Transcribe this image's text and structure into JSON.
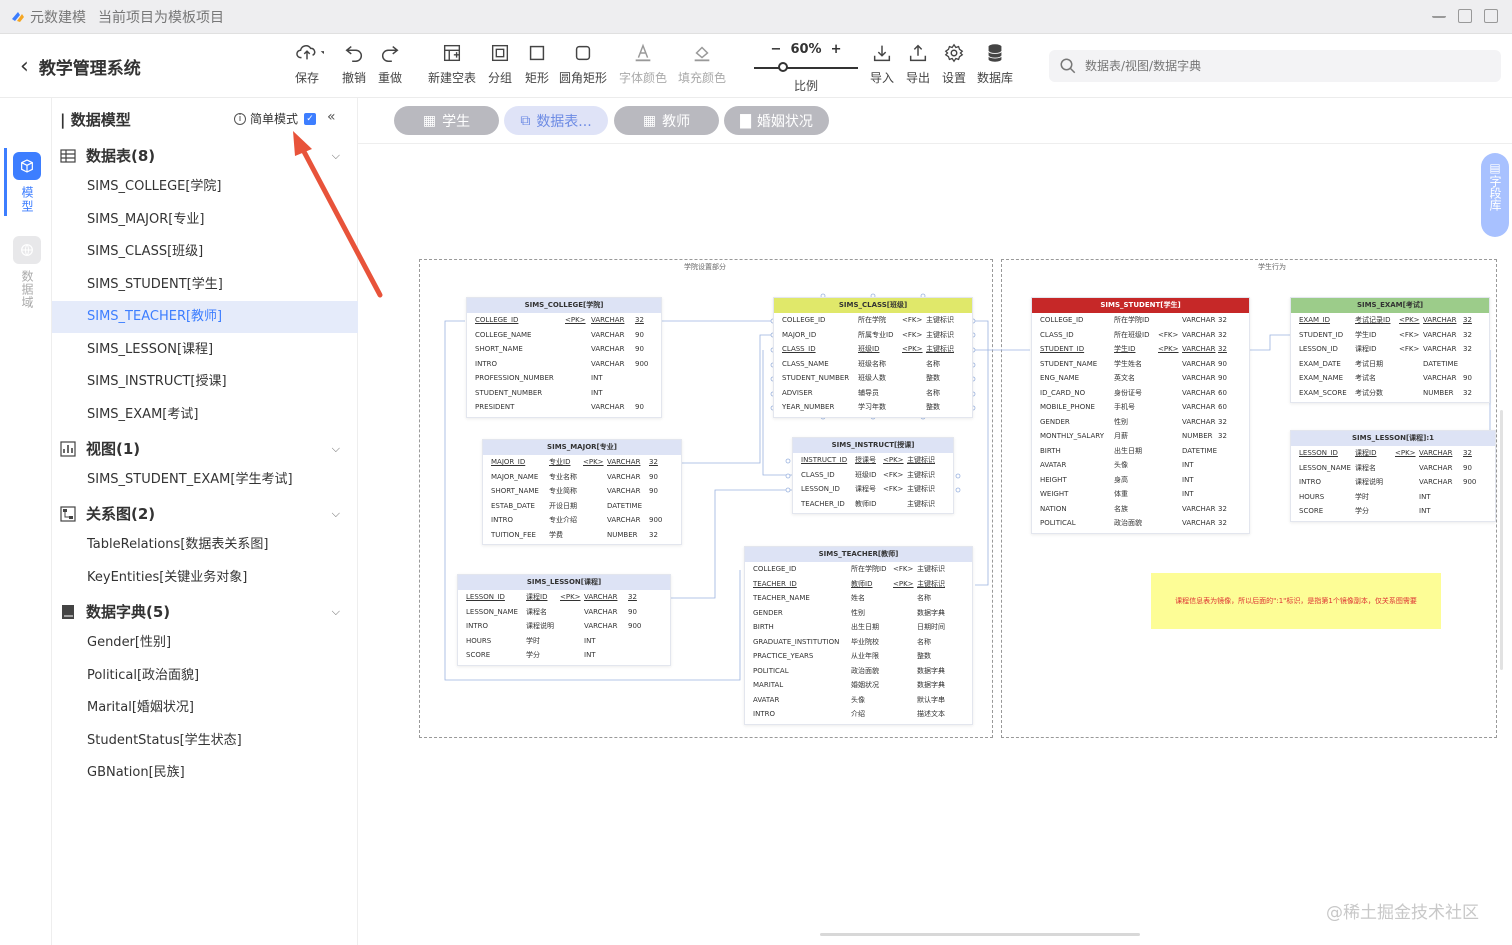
{
  "titlebar": {
    "app": "元数建模",
    "project_note": "当前项目为模板项目"
  },
  "header": {
    "back_title": "教学管理系统"
  },
  "toolbar": {
    "save": "保存",
    "undo": "撤销",
    "redo": "重做",
    "new_table": "新建空表",
    "group": "分组",
    "rect": "矩形",
    "round_rect": "圆角矩形",
    "font_color": "字体颜色",
    "fill_color": "填充颜色",
    "zoom": "60%",
    "zoom_value": 0.6,
    "scale_label": "比例",
    "import": "导入",
    "export": "导出",
    "settings": "设置",
    "database": "数据库"
  },
  "search": {
    "placeholder": "数据表/视图/数据字典"
  },
  "rail": {
    "model": "模型",
    "domain": "数据域"
  },
  "sidebar": {
    "title": "| 数据模型",
    "simple_mode": "简单模式",
    "tables_group": "数据表(8)",
    "tables": [
      "SIMS_COLLEGE[学院]",
      "SIMS_MAJOR[专业]",
      "SIMS_CLASS[班级]",
      "SIMS_STUDENT[学生]",
      "SIMS_TEACHER[教师]",
      "SIMS_LESSON[课程]",
      "SIMS_INSTRUCT[授课]",
      "SIMS_EXAM[考试]"
    ],
    "views_group": "视图(1)",
    "views": [
      "SIMS_STUDENT_EXAM[学生考试]"
    ],
    "relations_group": "关系图(2)",
    "relations": [
      "TableRelations[数据表关系图]",
      "KeyEntities[关键业务对象]"
    ],
    "dict_group": "数据字典(5)",
    "dicts": [
      "Gender[性别]",
      "Political[政治面貌]",
      "Marital[婚姻状况]",
      "StudentStatus[学生状态]",
      "GBNation[民族]"
    ]
  },
  "doc_tabs": [
    {
      "label": "学生",
      "icon": "table-icon"
    },
    {
      "label": "数据表...",
      "icon": "diagram-icon"
    },
    {
      "label": "教师",
      "icon": "table-icon"
    },
    {
      "label": "婚姻状况",
      "icon": "dict-icon"
    }
  ],
  "canvas": {
    "area1": "学院设置部分",
    "area2": "学生行为",
    "note": "课程信息表为镜像，所以后面的\":1\"标识，是指第1个镜像副本，仅关系图需要",
    "field_lib": "字段库",
    "entities": {
      "college": {
        "title": "SIMS_COLLEGE[学院]",
        "rows": [
          [
            "COLLEGE_ID",
            "<PK>",
            "VARCHAR",
            "32"
          ],
          [
            "COLLEGE_NAME",
            "",
            "VARCHAR",
            "90"
          ],
          [
            "SHORT_NAME",
            "",
            "VARCHAR",
            "90"
          ],
          [
            "INTRO",
            "",
            "VARCHAR",
            "900"
          ],
          [
            "PROFESSION_NUMBER",
            "",
            "INT",
            ""
          ],
          [
            "STUDENT_NUMBER",
            "",
            "INT",
            ""
          ],
          [
            "PRESIDENT",
            "",
            "VARCHAR",
            "90"
          ]
        ]
      },
      "major": {
        "title": "SIMS_MAJOR[专业]",
        "rows": [
          [
            "MAJOR_ID",
            "专业ID",
            "<PK>",
            "VARCHAR",
            "32"
          ],
          [
            "MAJOR_NAME",
            "专业名称",
            "",
            "VARCHAR",
            "90"
          ],
          [
            "SHORT_NAME",
            "专业简称",
            "",
            "VARCHAR",
            "90"
          ],
          [
            "ESTAB_DATE",
            "开设日期",
            "",
            "DATETIME",
            ""
          ],
          [
            "INTRO",
            "专业介绍",
            "",
            "VARCHAR",
            "900"
          ],
          [
            "TUITION_FEE",
            "学费",
            "",
            "NUMBER",
            "32"
          ]
        ]
      },
      "lesson": {
        "title": "SIMS_LESSON[课程]",
        "rows": [
          [
            "LESSON_ID",
            "课程ID",
            "<PK>",
            "VARCHAR",
            "32"
          ],
          [
            "LESSON_NAME",
            "课程名",
            "",
            "VARCHAR",
            "90"
          ],
          [
            "INTRO",
            "课程说明",
            "",
            "VARCHAR",
            "900"
          ],
          [
            "HOURS",
            "学时",
            "",
            "INT",
            ""
          ],
          [
            "SCORE",
            "学分",
            "",
            "INT",
            ""
          ]
        ]
      },
      "class": {
        "title": "SIMS_CLASS[班级]",
        "rows": [
          [
            "COLLEGE_ID",
            "所在学院",
            "<FK>",
            "主键标识"
          ],
          [
            "MAJOR_ID",
            "所属专业ID",
            "<FK>",
            "主键标识"
          ],
          [
            "CLASS_ID",
            "班级ID",
            "<PK>",
            "主键标识"
          ],
          [
            "CLASS_NAME",
            "班级名称",
            "",
            "名称"
          ],
          [
            "STUDENT_NUMBER",
            "班级人数",
            "",
            "整数"
          ],
          [
            "ADVISER",
            "辅导员",
            "",
            "名称"
          ],
          [
            "YEAR_NUMBER",
            "学习年数",
            "",
            "整数"
          ]
        ]
      },
      "instruct": {
        "title": "SIMS_INSTRUCT[授课]",
        "rows": [
          [
            "INSTRUCT_ID",
            "授课号",
            "<PK>",
            "主键标识"
          ],
          [
            "CLASS_ID",
            "班级ID",
            "<FK>",
            "主键标识"
          ],
          [
            "LESSON_ID",
            "课程号",
            "<FK>",
            "主键标识"
          ],
          [
            "TEACHER_ID",
            "教师ID",
            "",
            "主键标识"
          ]
        ]
      },
      "teacher": {
        "title": "SIMS_TEACHER[教师]",
        "rows": [
          [
            "COLLEGE_ID",
            "所在学院ID",
            "<FK>",
            "主键标识"
          ],
          [
            "TEACHER_ID",
            "教师ID",
            "<PK>",
            "主键标识"
          ],
          [
            "TEACHER_NAME",
            "姓名",
            "",
            "名称"
          ],
          [
            "GENDER",
            "性别",
            "",
            "数据字典"
          ],
          [
            "BIRTH",
            "出生日期",
            "",
            "日期时间"
          ],
          [
            "GRADUATE_INSTITUTION",
            "毕业院校",
            "",
            "名称"
          ],
          [
            "PRACTICE_YEARS",
            "从业年限",
            "",
            "整数"
          ],
          [
            "POLITICAL",
            "政治面貌",
            "",
            "数据字典"
          ],
          [
            "MARITAL",
            "婚姻状况",
            "",
            "数据字典"
          ],
          [
            "AVATAR",
            "头像",
            "",
            "默认字串"
          ],
          [
            "INTRO",
            "介绍",
            "",
            "描述文本"
          ]
        ]
      },
      "student": {
        "title": "SIMS_STUDENT[学生]",
        "rows": [
          [
            "COLLEGE_ID",
            "所在学院ID",
            "",
            "VARCHAR",
            "32"
          ],
          [
            "CLASS_ID",
            "所在班级ID",
            "<FK>",
            "VARCHAR",
            "32"
          ],
          [
            "STUDENT_ID",
            "学生ID",
            "<PK>",
            "VARCHAR",
            "32"
          ],
          [
            "STUDENT_NAME",
            "学生姓名",
            "",
            "VARCHAR",
            "90"
          ],
          [
            "ENG_NAME",
            "英文名",
            "",
            "VARCHAR",
            "90"
          ],
          [
            "ID_CARD_NO",
            "身份证号",
            "",
            "VARCHAR",
            "60"
          ],
          [
            "MOBILE_PHONE",
            "手机号",
            "",
            "VARCHAR",
            "60"
          ],
          [
            "GENDER",
            "性别",
            "",
            "VARCHAR",
            "32"
          ],
          [
            "MONTHLY_SALARY",
            "月薪",
            "",
            "NUMBER",
            "32"
          ],
          [
            "BIRTH",
            "出生日期",
            "",
            "DATETIME",
            ""
          ],
          [
            "AVATAR",
            "头像",
            "",
            "INT",
            ""
          ],
          [
            "HEIGHT",
            "身高",
            "",
            "INT",
            ""
          ],
          [
            "WEIGHT",
            "体重",
            "",
            "INT",
            ""
          ],
          [
            "NATION",
            "名族",
            "",
            "VARCHAR",
            "32"
          ],
          [
            "POLITICAL",
            "政治面貌",
            "",
            "VARCHAR",
            "32"
          ]
        ]
      },
      "exam": {
        "title": "SIMS_EXAM[考试]",
        "rows": [
          [
            "EXAM_ID",
            "考试记录ID",
            "<PK>",
            "VARCHAR",
            "32"
          ],
          [
            "STUDENT_ID",
            "学生ID",
            "<FK>",
            "VARCHAR",
            "32"
          ],
          [
            "LESSON_ID",
            "课程ID",
            "<FK>",
            "VARCHAR",
            "32"
          ],
          [
            "EXAM_DATE",
            "考试日期",
            "",
            "DATETIME",
            ""
          ],
          [
            "EXAM_NAME",
            "考试名",
            "",
            "VARCHAR",
            "90"
          ],
          [
            "EXAM_SCORE",
            "考试分数",
            "",
            "NUMBER",
            "32"
          ]
        ]
      },
      "lesson1": {
        "title": "SIMS_LESSON[课程]:1",
        "rows": [
          [
            "LESSON_ID",
            "课程ID",
            "<PK>",
            "VARCHAR",
            "32"
          ],
          [
            "LESSON_NAME",
            "课程名",
            "",
            "VARCHAR",
            "90"
          ],
          [
            "INTRO",
            "课程说明",
            "",
            "VARCHAR",
            "900"
          ],
          [
            "HOURS",
            "学时",
            "",
            "INT",
            ""
          ],
          [
            "SCORE",
            "学分",
            "",
            "INT",
            ""
          ]
        ]
      }
    }
  },
  "colors": {
    "accent": "#3d7eff",
    "student_header": "#c62828",
    "exam_header": "#9ccc8a",
    "class_header": "#e0e86a",
    "default_header": "#dde3f5",
    "note_bg": "#fdfd96",
    "arrow": "#e8533a"
  },
  "watermark": "@稀土掘金技术社区"
}
